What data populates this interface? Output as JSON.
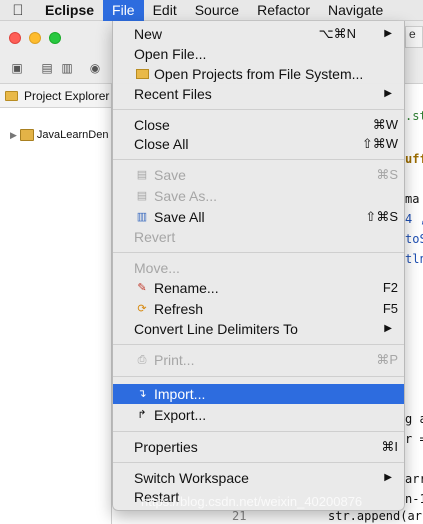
{
  "menubar": {
    "apple_icon": "apple-icon",
    "items": [
      "Eclipse",
      "File",
      "Edit",
      "Source",
      "Refactor",
      "Navigate"
    ]
  },
  "window": {
    "explorer_title": "Project Explorer",
    "project_name": "JavaLearnDen",
    "tab_fragment": "e",
    "code_fragments": [
      ".st",
      "uff",
      "ma",
      "4 ,",
      "toS",
      "tln(",
      "g a",
      "r =",
      "arr",
      "n-1",
      "str.append(arr"
    ],
    "line_number": "21"
  },
  "file_menu": {
    "new": {
      "label": "New",
      "shortcut": "⌥⌘N"
    },
    "open_file": {
      "label": "Open File..."
    },
    "open_projects": {
      "label": "Open Projects from File System...",
      "icon": "folder-icon"
    },
    "recent_files": {
      "label": "Recent Files"
    },
    "close": {
      "label": "Close",
      "shortcut": "⌘W"
    },
    "close_all": {
      "label": "Close All",
      "shortcut": "⇧⌘W"
    },
    "save": {
      "label": "Save",
      "shortcut": "⌘S",
      "icon": "save-icon"
    },
    "save_as": {
      "label": "Save As...",
      "icon": "save-as-icon"
    },
    "save_all": {
      "label": "Save All",
      "shortcut": "⇧⌘S",
      "icon": "save-all-icon"
    },
    "revert": {
      "label": "Revert"
    },
    "move": {
      "label": "Move..."
    },
    "rename": {
      "label": "Rename...",
      "shortcut": "F2",
      "icon": "rename-icon"
    },
    "refresh": {
      "label": "Refresh",
      "shortcut": "F5",
      "icon": "refresh-icon"
    },
    "convert": {
      "label": "Convert Line Delimiters To"
    },
    "print": {
      "label": "Print...",
      "shortcut": "⌘P",
      "icon": "print-icon"
    },
    "import": {
      "label": "Import...",
      "icon": "import-icon"
    },
    "export": {
      "label": "Export...",
      "icon": "export-icon"
    },
    "properties": {
      "label": "Properties",
      "shortcut": "⌘I"
    },
    "switch_workspace": {
      "label": "Switch Workspace"
    },
    "restart": {
      "label": "Restart"
    }
  },
  "watermark": "https://blog.csdn.net/weixin_40200876",
  "colors": {
    "highlight": "#2d6cdf",
    "code_green": "#2e7d32",
    "code_blue": "#1e4fb3"
  }
}
